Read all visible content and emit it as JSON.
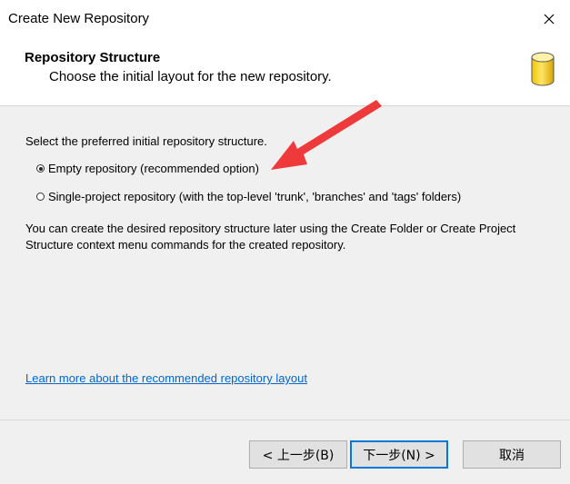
{
  "window": {
    "title": "Create New Repository",
    "close_icon": "close-icon"
  },
  "header": {
    "title": "Repository Structure",
    "subtitle": "Choose the initial layout for the new repository.",
    "icon": "database-icon"
  },
  "content": {
    "prompt": "Select the preferred initial repository structure.",
    "options": [
      {
        "label": "Empty repository (recommended option)",
        "checked": true
      },
      {
        "label": "Single-project repository (with the top-level 'trunk', 'branches' and 'tags' folders)",
        "checked": false
      }
    ],
    "note_line1": "You can create the desired repository structure later using the Create Folder or Create Project",
    "note_line2": "Structure context menu commands for the created repository.",
    "link": "Learn more about the recommended repository layout"
  },
  "buttons": {
    "back": "< 上一步(B)",
    "next": "下一步(N) >",
    "cancel": "取消"
  },
  "colors": {
    "annotation_arrow": "#ee3a3a",
    "link": "#0066cc",
    "default_button_border": "#0078d7"
  }
}
